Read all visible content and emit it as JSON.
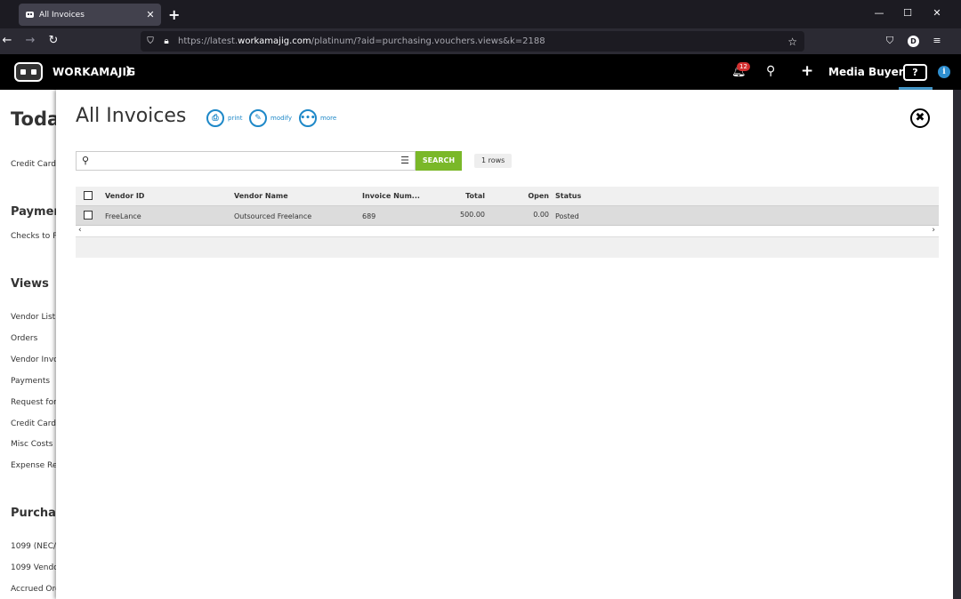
{
  "browser": {
    "tab_title": "All Invoices",
    "url_prefix": "https://latest.",
    "url_domain": "workamajig.com",
    "url_suffix": "/platinum/?aid=purchasing.vouchers.views&k=2188",
    "profile_initial": "D"
  },
  "app": {
    "brand": "WORKAMAJIG",
    "notification_count": "12",
    "role": "Media Buyer",
    "help_label": "?",
    "info_label": "i",
    "accent_color": "#1e88c8",
    "search_button_color": "#7ab829"
  },
  "background": {
    "heading_today": "Toda",
    "item_credit_cards": "Credit Cards",
    "heading_payments": "Paymen",
    "item_checks": "Checks to Pr",
    "heading_views": "Views",
    "views": [
      "Vendor List",
      "Orders",
      "Vendor Invo",
      "Payments",
      "Request for",
      "Credit Card (",
      "Misc Costs",
      "Expense Rep"
    ],
    "heading_purchasing": "Purchas",
    "purchasing": [
      "1099 (NEC/M",
      "1099 Vendor",
      "Accrued Ord"
    ]
  },
  "modal": {
    "title": "All Invoices",
    "actions": {
      "print": "print",
      "modify": "modify",
      "more": "more"
    },
    "search": {
      "value": "",
      "button": "SEARCH",
      "rows": "1 rows"
    },
    "columns": {
      "vendor_id": "Vendor ID",
      "vendor_name": "Vendor Name",
      "invoice_number": "Invoice Num...",
      "total": "Total",
      "open": "Open",
      "status": "Status"
    },
    "rows": [
      {
        "vendor_id": "FreeLance",
        "vendor_name": "Outsourced Freelance",
        "invoice_number": "689",
        "total": "500.00",
        "open": "0.00",
        "status": "Posted"
      }
    ]
  }
}
